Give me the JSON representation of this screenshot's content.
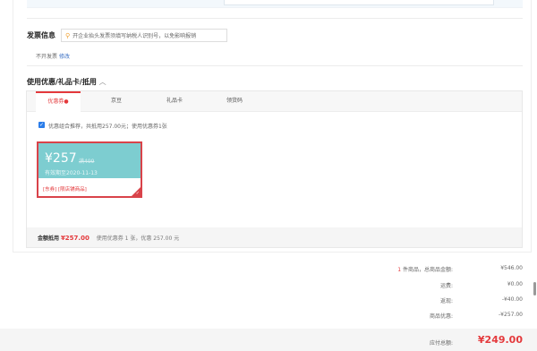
{
  "invoice": {
    "title": "发票信息",
    "hint": "开企业抬头发票须填写纳税人识别号，以免影响报销",
    "status": "不开发票",
    "modify_link": "修改"
  },
  "discount_section": {
    "title": "使用优惠/礼品卡/抵用",
    "tabs": [
      {
        "label": "优惠券",
        "active": true
      },
      {
        "label": "京豆"
      },
      {
        "label": "礼品卡"
      },
      {
        "label": "领货码"
      }
    ],
    "combo_text": "优惠组合推荐，共抵用257.00元；使用优惠券1张",
    "coupon": {
      "price": "¥257",
      "original": "满499",
      "expiry": "有效期至2020-11-13",
      "desc": "[东券] [限店铺商品]"
    },
    "summary": {
      "label": "金额抵用",
      "amount": "¥257.00",
      "detail": "使用优惠券 1 张，优惠 257.00 元"
    }
  },
  "totals": {
    "count": "1",
    "count_suffix": "件商品，总商品金额:",
    "goods_amount": "¥546.00",
    "shipping_label": "运费:",
    "shipping": "¥0.00",
    "rebate_label": "返现:",
    "rebate": "-¥40.00",
    "discount_label": "商品优惠:",
    "discount": "-¥257.00",
    "payable_label": "应付总额:",
    "payable": "¥249.00"
  },
  "colors": {
    "accent": "#e4393c",
    "coupon_teal": "#7dcdd0",
    "link": "#3a6fc4"
  }
}
